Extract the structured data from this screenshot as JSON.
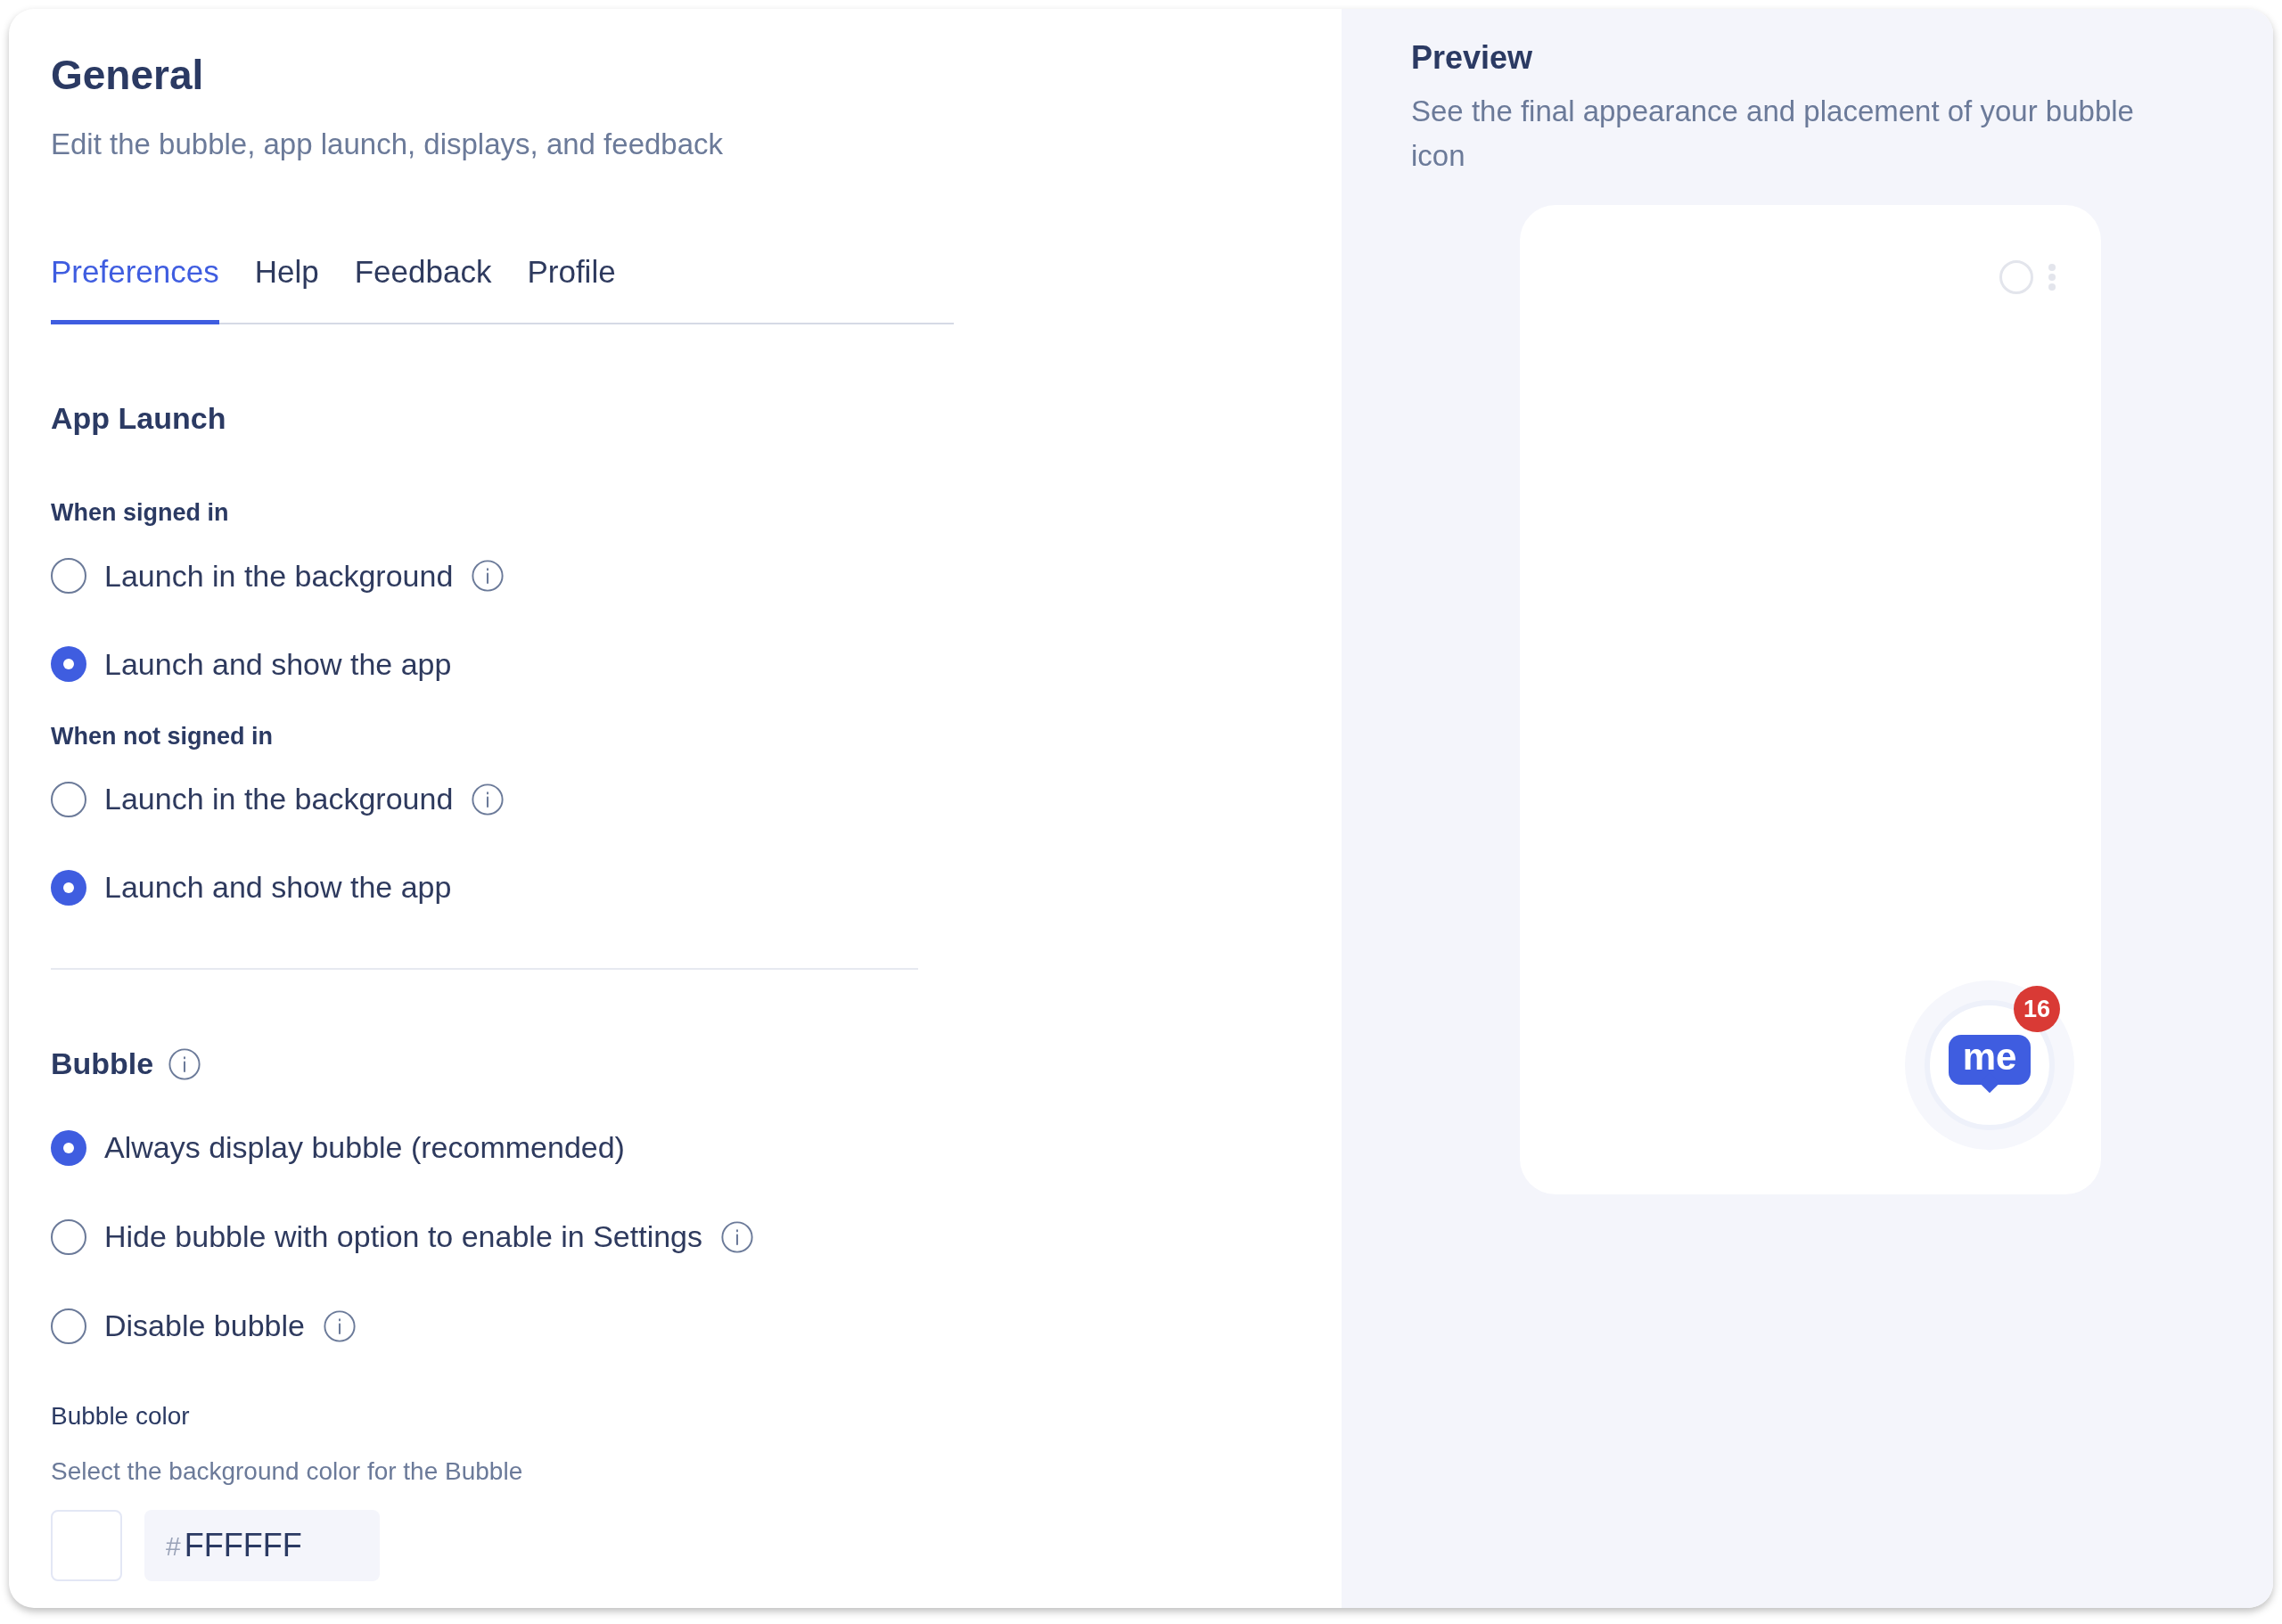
{
  "header": {
    "title": "General",
    "subtitle": "Edit the bubble, app launch, displays, and feedback"
  },
  "tabs": [
    {
      "label": "Preferences",
      "selected": true
    },
    {
      "label": "Help",
      "selected": false
    },
    {
      "label": "Feedback",
      "selected": false
    },
    {
      "label": "Profile",
      "selected": false
    }
  ],
  "app_launch": {
    "title": "App Launch",
    "groups": [
      {
        "label": "When signed in",
        "options": [
          {
            "label": "Launch in the background",
            "selected": false,
            "info": true
          },
          {
            "label": "Launch and show the app",
            "selected": true,
            "info": false
          }
        ]
      },
      {
        "label": "When not signed in",
        "options": [
          {
            "label": "Launch in the background",
            "selected": false,
            "info": true
          },
          {
            "label": "Launch and show the app",
            "selected": true,
            "info": false
          }
        ]
      }
    ]
  },
  "bubble": {
    "title": "Bubble",
    "info": true,
    "options": [
      {
        "label": "Always display bubble (recommended)",
        "selected": true,
        "info": false
      },
      {
        "label": "Hide bubble with option to enable in Settings",
        "selected": false,
        "info": true
      },
      {
        "label": "Disable bubble",
        "selected": false,
        "info": true
      }
    ],
    "color_label": "Bubble color",
    "color_hint": "Select the background color for the Bubble",
    "hash": "#",
    "color_value": "FFFFFF",
    "color": "#ffffff"
  },
  "preview": {
    "title": "Preview",
    "subtitle": "See the final appearance and placement of your bubble icon",
    "logo_text": "me",
    "badge": "16"
  }
}
